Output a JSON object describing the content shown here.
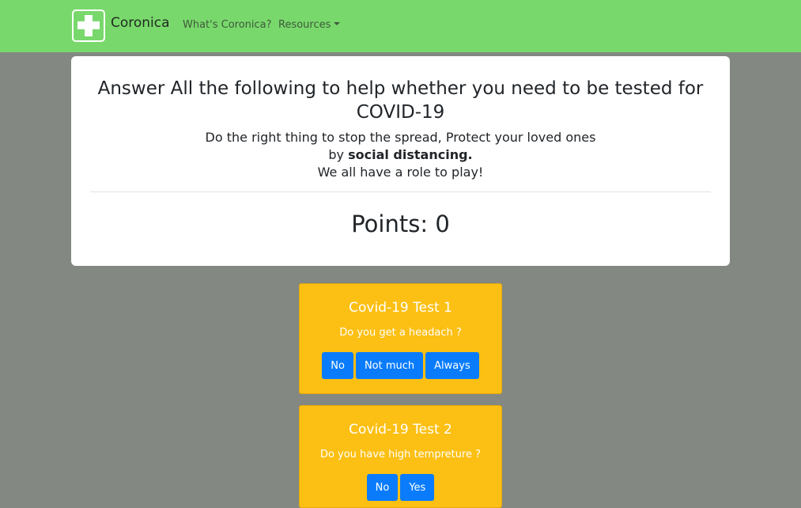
{
  "navbar": {
    "brand": "Coronica",
    "links": [
      {
        "label": "What's Coronica?"
      },
      {
        "label": "Resources"
      }
    ]
  },
  "intro": {
    "title": "Answer All the following to help whether you need to be tested for COVID-19",
    "line1": "Do the right thing to stop the spread, Protect your loved ones",
    "line2_prefix": "by ",
    "line2_bold": "social distancing.",
    "line3": "We all have a role to play!",
    "points": "Points: 0"
  },
  "tests": [
    {
      "title": "Covid-19 Test 1",
      "question": "Do you get a headach ?",
      "answers": [
        "No",
        "Not much",
        "Always"
      ]
    },
    {
      "title": "Covid-19 Test 2",
      "question": "Do you have high tempreture ?",
      "answers": [
        "No",
        "Yes"
      ]
    }
  ],
  "colors": {
    "navbar": "#79d86c",
    "background": "#838882",
    "card": "#fcbf13",
    "button": "#0a7cfb"
  }
}
